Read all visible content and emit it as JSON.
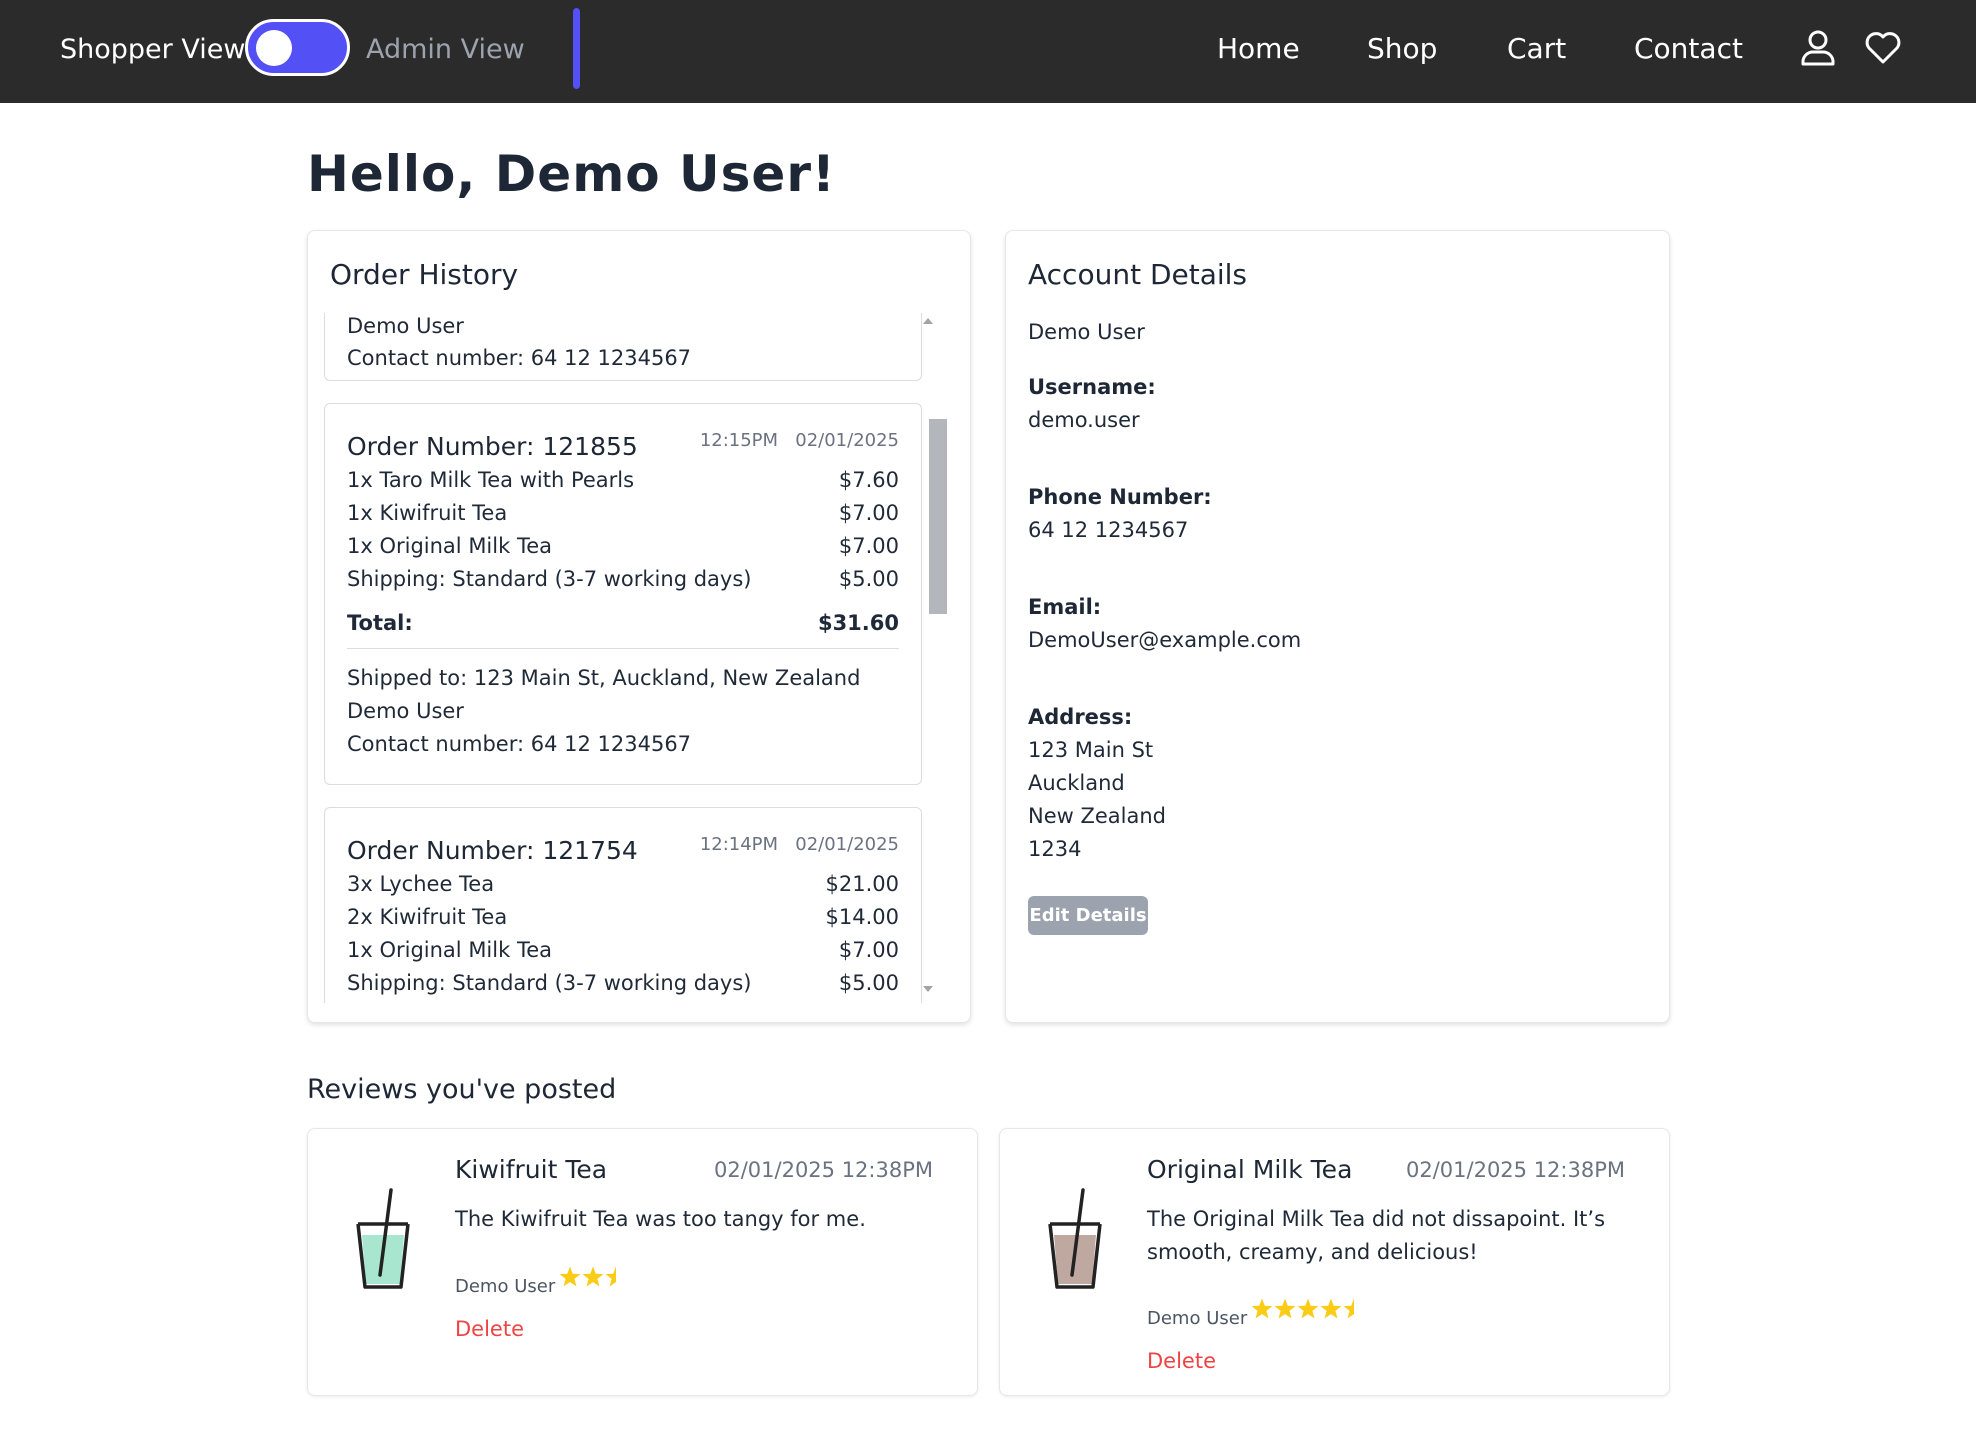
{
  "topbar": {
    "shopper_label": "Shopper View",
    "admin_label": "Admin View",
    "nav": {
      "home": "Home",
      "shop": "Shop",
      "cart": "Cart",
      "contact": "Contact"
    },
    "accent_color": "#5350f5"
  },
  "greeting": "Hello, Demo User!",
  "order_history": {
    "title": "Order History",
    "partial_top": {
      "name": "Demo User",
      "contact": "Contact number: 64 12 1234567"
    },
    "orders": [
      {
        "number": "Order Number: 121855",
        "time": "12:15PM",
        "date": "02/01/2025",
        "items": [
          {
            "label": "1x Taro Milk Tea with Pearls",
            "price": "$7.60"
          },
          {
            "label": "1x Kiwifruit Tea",
            "price": "$7.00"
          },
          {
            "label": "1x Original Milk Tea",
            "price": "$7.00"
          },
          {
            "label": "Shipping: Standard (3-7 working days)",
            "price": "$5.00"
          }
        ],
        "total_label": "Total:",
        "total": "$31.60",
        "shipped_to": "Shipped to: 123 Main St, Auckland, New Zealand",
        "name": "Demo User",
        "contact": "Contact number: 64 12 1234567"
      },
      {
        "number": "Order Number: 121754",
        "time": "12:14PM",
        "date": "02/01/2025",
        "items": [
          {
            "label": "3x Lychee Tea",
            "price": "$21.00"
          },
          {
            "label": "2x Kiwifruit Tea",
            "price": "$14.00"
          },
          {
            "label": "1x Original Milk Tea",
            "price": "$7.00"
          },
          {
            "label": "Shipping: Standard (3-7 working days)",
            "price": "$5.00"
          }
        ]
      }
    ]
  },
  "account": {
    "title": "Account Details",
    "name": "Demo User",
    "username_label": "Username:",
    "username": "demo.user",
    "phone_label": "Phone Number:",
    "phone": "64 12 1234567",
    "email_label": "Email:",
    "email": "DemoUser@example.com",
    "address_label": "Address:",
    "address": [
      "123 Main St",
      "Auckland",
      "New Zealand",
      "1234"
    ],
    "edit_button": "Edit Details"
  },
  "reviews": {
    "title": "Reviews you've posted",
    "items": [
      {
        "product": "Kiwifruit Tea",
        "datetime": "02/01/2025 12:38PM",
        "text": "The Kiwifruit Tea was too tangy for me.",
        "author": "Demo User",
        "rating": 2.5,
        "delete_label": "Delete",
        "drink_color": "#a8e6cf"
      },
      {
        "product": "Original Milk Tea",
        "datetime": "02/01/2025 12:38PM",
        "text": "The Original Milk Tea did not dissapoint. It’s smooth, creamy, and delicious!",
        "author": "Demo User",
        "rating": 4.5,
        "delete_label": "Delete",
        "drink_color": "#bfa8a0"
      }
    ],
    "star_color": "#facc15"
  }
}
